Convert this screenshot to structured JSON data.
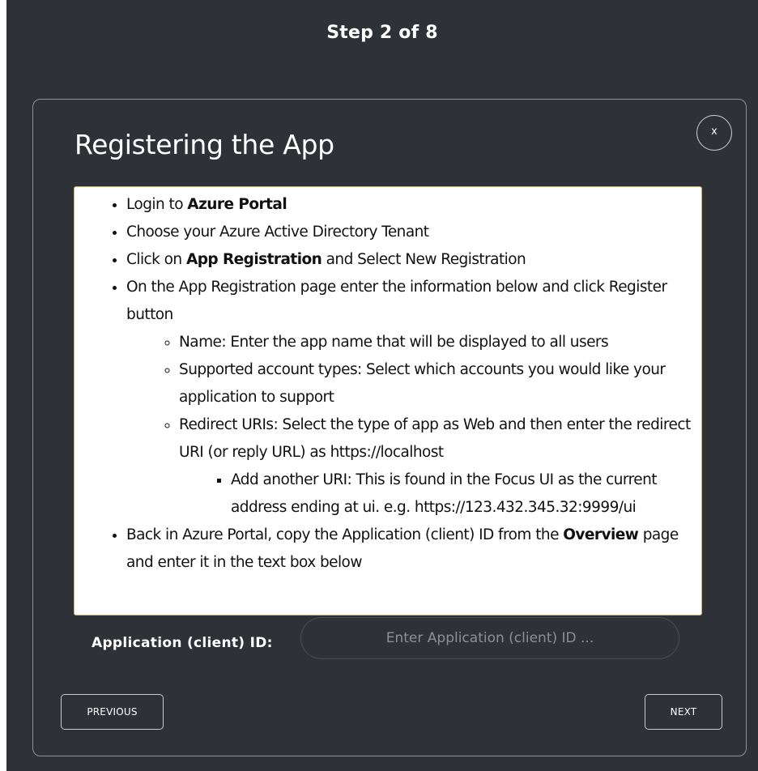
{
  "header": {
    "step_label": "Step 2 of  8"
  },
  "dialog": {
    "title": "Registering the App",
    "close_label": "x",
    "instructions": [
      {
        "prefix": "Login to ",
        "bold": "Azure Portal",
        "suffix": ""
      },
      {
        "text": "Choose your Azure Active Directory Tenant"
      },
      {
        "prefix": "Click on ",
        "bold": "App Registration",
        "suffix": " and Select New Registration"
      },
      {
        "text": "On the App Registration page enter the information below and click Register button",
        "subitems": [
          {
            "text": "Name: Enter the app name that will be displayed to all users"
          },
          {
            "text": "Supported account types: Select which accounts you would like your application to support"
          },
          {
            "text": "Redirect URIs: Select the type of app as Web and then enter the redirect URI (or reply URL) as https://localhost",
            "subitems": [
              {
                "text": "Add another URI: This is found in the Focus UI as the current address ending at ui. e.g. https://123.432.345.32:9999/ui"
              }
            ]
          }
        ]
      },
      {
        "prefix": "Back in Azure Portal, copy the Application (client) ID from the ",
        "bold": "Overview",
        "suffix": " page and enter it in the text box below"
      }
    ],
    "client_id": {
      "label": "Application (client) ID:",
      "placeholder": "Enter Application (client) ID ...",
      "value": ""
    },
    "buttons": {
      "previous_label": "PREVIOUS",
      "next_label": "NEXT"
    }
  }
}
